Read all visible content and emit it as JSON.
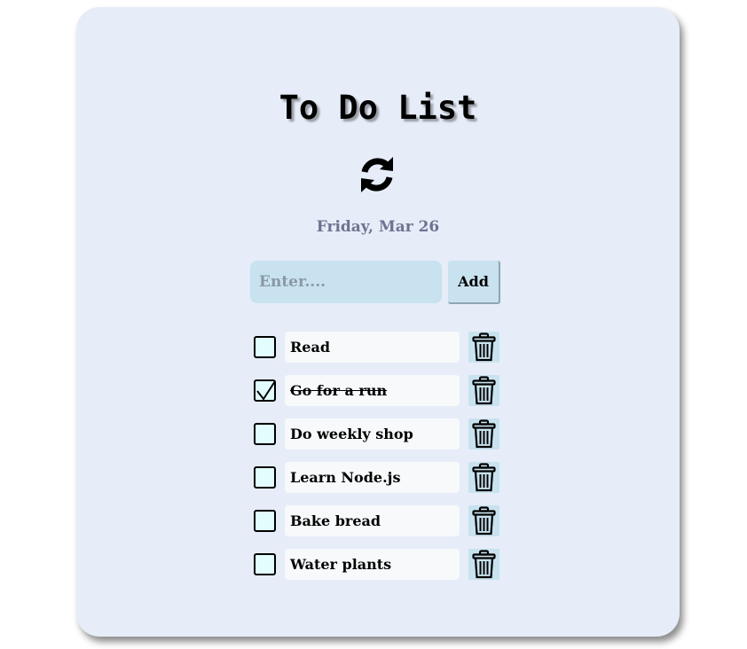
{
  "app": {
    "title": "To Do List",
    "date": "Friday, Mar 26",
    "refresh_icon": "refresh-icon"
  },
  "form": {
    "input_value": "",
    "input_placeholder": "Enter....",
    "add_label": "Add"
  },
  "tasks": [
    {
      "text": "Read",
      "done": false
    },
    {
      "text": "Go for a run",
      "done": true
    },
    {
      "text": "Do weekly shop",
      "done": false
    },
    {
      "text": "Learn Node.js",
      "done": false
    },
    {
      "text": "Bake bread",
      "done": false
    },
    {
      "text": "Water plants",
      "done": false
    }
  ],
  "icons": {
    "delete": "trash-icon",
    "check": "checkmark-icon"
  },
  "colors": {
    "card_background": "#e6edf8",
    "input_background": "#c8e2ef",
    "checkbox_background": "#e2fdfd",
    "date_text": "#6d7391"
  }
}
